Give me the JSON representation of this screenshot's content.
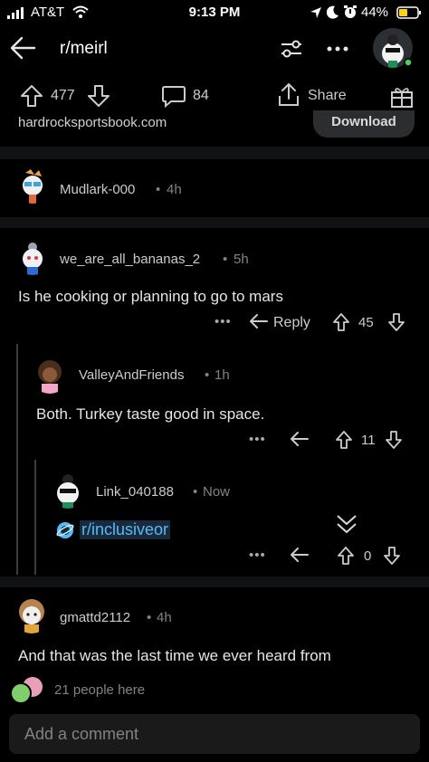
{
  "status_bar": {
    "carrier": "AT&T",
    "time": "9:13 PM",
    "battery": "44%"
  },
  "header": {
    "subreddit": "r/meirl"
  },
  "post_actions": {
    "upvotes": "477",
    "comments": "84",
    "share_label": "Share"
  },
  "ad": {
    "domain": "hardrocksportsbook.com",
    "button_label": "Download"
  },
  "comments": [
    {
      "username": "Mudlark-000",
      "time": "4h"
    },
    {
      "username": "we_are_all_bananas_2",
      "time": "5h",
      "text": "Is he cooking or planning to go to mars",
      "reply_label": "Reply",
      "score": "45"
    },
    {
      "username": "ValleyAndFriends",
      "time": "1h",
      "text": "Both. Turkey taste good in space.",
      "score": "11"
    },
    {
      "username": "Link_040188",
      "time": "Now",
      "link": "r/inclusiveor",
      "score": "0"
    },
    {
      "username": "gmattd2112",
      "time": "4h",
      "text": "And that was the last time we ever heard from"
    }
  ],
  "presence": {
    "text": "21 people here"
  },
  "composer": {
    "placeholder": "Add a comment"
  },
  "colors": {
    "background": "#000000",
    "link": "#4fbcff",
    "online": "#46d160"
  }
}
